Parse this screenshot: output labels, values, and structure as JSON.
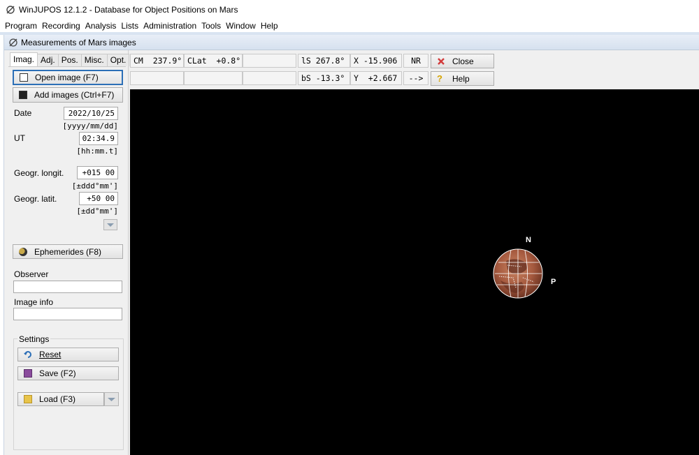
{
  "window": {
    "title": "WinJUPOS 12.1.2 - Database for Object Positions on Mars"
  },
  "menu": [
    "Program",
    "Recording",
    "Analysis",
    "Lists",
    "Administration",
    "Tools",
    "Window",
    "Help"
  ],
  "child_window": {
    "title": "Measurements of Mars images"
  },
  "tabs": [
    "Imag.",
    "Adj.",
    "Pos.",
    "Misc.",
    "Opt."
  ],
  "active_tab": "Imag.",
  "buttons": {
    "open_image": "Open image (F7)",
    "add_images": "Add images (Ctrl+F7)",
    "ephemerides": "Ephemerides (F8)",
    "reset": "Reset",
    "save": "Save (F2)",
    "load": "Load (F3)",
    "close": "Close",
    "help": "Help"
  },
  "fields": {
    "date": {
      "label": "Date",
      "value": "2022/10/25",
      "hint": "[yyyy/mm/dd]"
    },
    "ut": {
      "label": "UT",
      "value": "02:34.9",
      "hint": "[hh:mm.t]"
    },
    "longitude": {
      "label": "Geogr. longit.",
      "value": "+015 00",
      "hint": "[±ddd°mm']"
    },
    "latitude": {
      "label": "Geogr. latit.",
      "value": "+50 00",
      "hint": "[±dd°mm']"
    },
    "observer": {
      "label": "Observer",
      "value": ""
    },
    "image_info": {
      "label": "Image info",
      "value": ""
    }
  },
  "settings": {
    "label": "Settings"
  },
  "readouts": {
    "cm": "CM  237.9°",
    "clat": "CLat  +0.8°",
    "ls": "lS 267.8°",
    "x": "X -15.906",
    "nr": "NR",
    "bs": "bS -13.3°",
    "y": "Y  +2.667",
    "arrow": "-->"
  },
  "planet": {
    "north_label": "N",
    "p_label": "P"
  },
  "colors": {
    "accent": "#2c6fb7",
    "canvas": "#000000",
    "mars": "#b5654a"
  }
}
